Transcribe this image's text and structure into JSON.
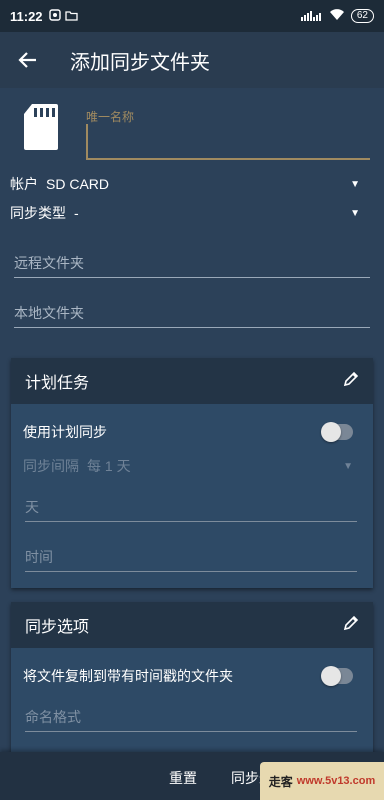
{
  "status_bar": {
    "time": "11:22",
    "battery": "62"
  },
  "app_bar": {
    "title": "添加同步文件夹"
  },
  "name_field": {
    "placeholder": "唯一名称",
    "value": ""
  },
  "account": {
    "label": "帐户",
    "value": "SD CARD"
  },
  "sync_type": {
    "label": "同步类型",
    "value": "-"
  },
  "remote_folder": {
    "placeholder": "远程文件夹"
  },
  "local_folder": {
    "placeholder": "本地文件夹"
  },
  "schedule_card": {
    "title": "计划任务",
    "use_schedule_label": "使用计划同步",
    "use_schedule_on": false,
    "interval_label": "同步间隔",
    "interval_value": "每 1 天",
    "days_placeholder": "天",
    "time_placeholder": "时间"
  },
  "sync_options_card": {
    "title": "同步选项",
    "timestamp_label": "将文件复制到带有时间戳的文件夹",
    "timestamp_on": false,
    "naming_format_placeholder": "命名格式"
  },
  "bottom_bar": {
    "reset": "重置",
    "sync_filter": "同步过滤"
  },
  "watermark": {
    "text": "走客",
    "site": "www.5v13.com"
  }
}
